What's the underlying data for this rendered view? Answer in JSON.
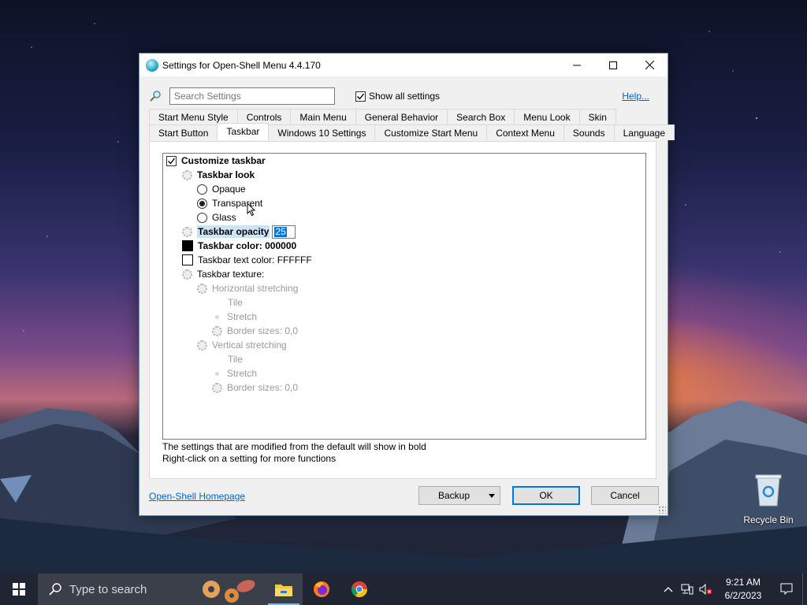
{
  "window": {
    "title": "Settings for Open-Shell Menu 4.4.170",
    "minimize_icon": "minimize-icon",
    "maximize_icon": "maximize-icon",
    "close_icon": "close-icon"
  },
  "search": {
    "placeholder": "Search Settings",
    "value": "",
    "show_all_label": "Show all settings",
    "show_all_checked": true,
    "help_label": "Help..."
  },
  "tabs": {
    "row1": [
      "Start Menu Style",
      "Controls",
      "Main Menu",
      "General Behavior",
      "Search Box",
      "Menu Look",
      "Skin"
    ],
    "row2": [
      "Start Button",
      "Taskbar",
      "Windows 10 Settings",
      "Customize Start Menu",
      "Context Menu",
      "Sounds",
      "Language"
    ],
    "active": "Taskbar"
  },
  "tree": {
    "customize_taskbar": "Customize taskbar",
    "taskbar_look": "Taskbar look",
    "opaque": "Opaque",
    "transparent": "Transparent",
    "glass": "Glass",
    "selected_look": "Transparent",
    "taskbar_opacity": "Taskbar opacity",
    "opacity_value": "25",
    "taskbar_color": "Taskbar color: 000000",
    "taskbar_text_color": "Taskbar text color: FFFFFF",
    "taskbar_texture": "Taskbar texture:",
    "horizontal_stretching": "Horizontal stretching",
    "h_tile": "Tile",
    "h_stretch": "Stretch",
    "h_border": "Border sizes: 0,0",
    "vertical_stretching": "Vertical stretching",
    "v_tile": "Tile",
    "v_stretch": "Stretch",
    "v_border": "Border sizes: 0,0",
    "taskbar_color_hex": "#000000",
    "taskbar_text_color_hex": "#FFFFFF"
  },
  "hints": {
    "line1": "The settings that are modified from the default will show in bold",
    "line2": "Right-click on a setting for more functions"
  },
  "footer": {
    "homepage_link": "Open-Shell Homepage",
    "backup": "Backup",
    "ok": "OK",
    "cancel": "Cancel"
  },
  "desktop": {
    "recycle_bin": "Recycle Bin"
  },
  "taskbar": {
    "search_placeholder": "Type to search",
    "time": "9:21 AM",
    "date": "6/2/2023",
    "apps": [
      "file-explorer-icon",
      "firefox-icon",
      "chrome-icon"
    ]
  },
  "colors": {
    "accent": "#0078d7",
    "link": "#0066cc",
    "taskbar_bg": "#1f2532"
  }
}
